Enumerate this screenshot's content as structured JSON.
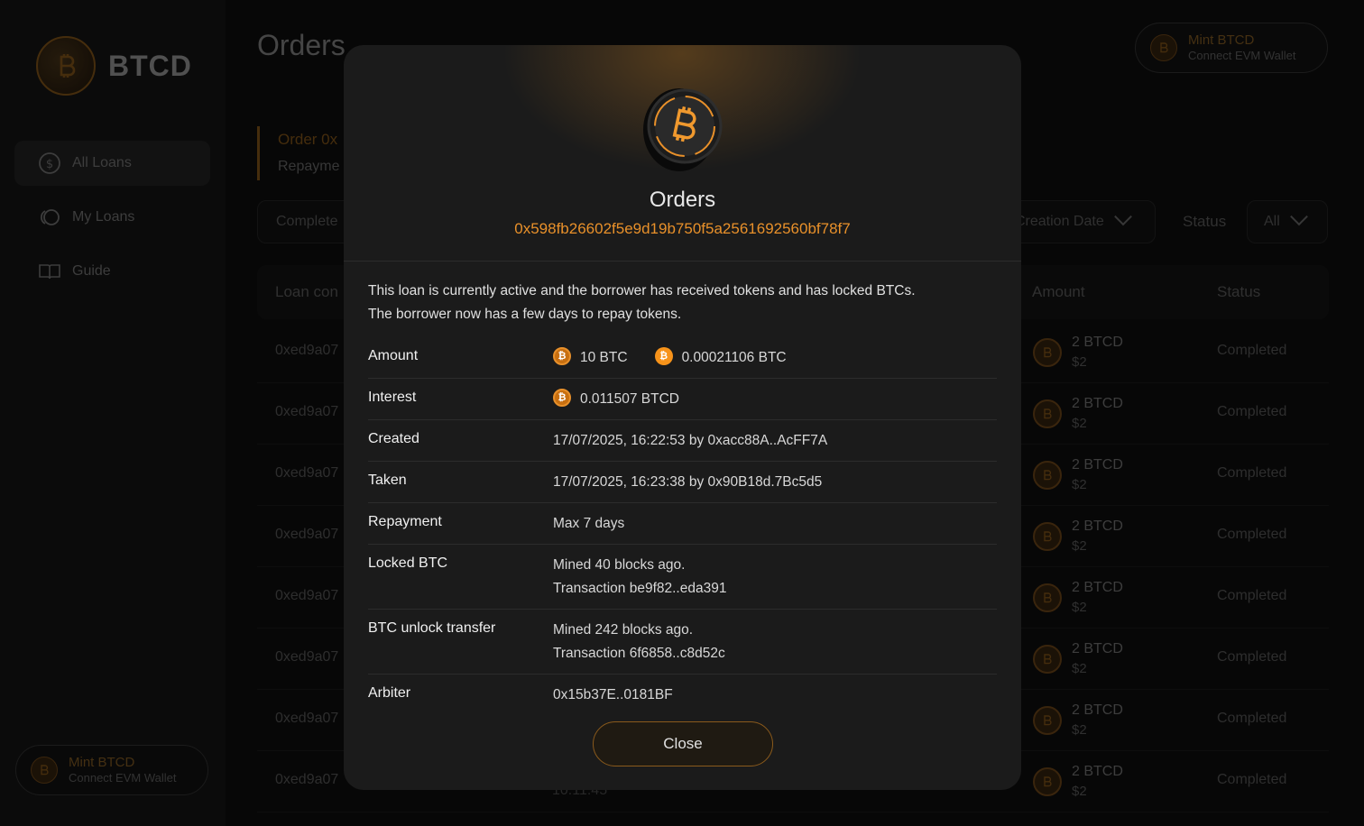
{
  "app": {
    "brand": "BTCD",
    "page_title": "Orders"
  },
  "sidebar": {
    "items": [
      {
        "label": "All Loans",
        "icon": "dollar-circle-icon",
        "active": true
      },
      {
        "label": "My Loans",
        "icon": "loop-icon",
        "active": false
      },
      {
        "label": "Guide",
        "icon": "book-icon",
        "active": false
      }
    ],
    "mint": {
      "title": "Mint BTCD",
      "subtitle": "Connect EVM Wallet"
    }
  },
  "header": {
    "mint": {
      "title": "Mint BTCD",
      "subtitle": "Connect EVM Wallet"
    }
  },
  "background": {
    "order_card": {
      "line1": "Order 0x",
      "line2": "Repayme"
    },
    "filters": {
      "completed": "Complete",
      "creation_date": "Creation Date",
      "status_label": "Status",
      "status_value": "All"
    },
    "columns": {
      "loan": "Loan con",
      "amount": "Amount",
      "status": "Status"
    },
    "rows": [
      {
        "id": "0xed9a07",
        "amount": "2 BTCD",
        "usd": "$2",
        "status": "Completed"
      },
      {
        "id": "0xed9a07",
        "amount": "2 BTCD",
        "usd": "$2",
        "status": "Completed"
      },
      {
        "id": "0xed9a07",
        "amount": "2 BTCD",
        "usd": "$2",
        "status": "Completed"
      },
      {
        "id": "0xed9a07",
        "amount": "2 BTCD",
        "usd": "$2",
        "status": "Completed"
      },
      {
        "id": "0xed9a07",
        "amount": "2 BTCD",
        "usd": "$2",
        "status": "Completed"
      },
      {
        "id": "0xed9a07",
        "amount": "2 BTCD",
        "usd": "$2",
        "status": "Completed"
      },
      {
        "id": "0xed9a07",
        "amount": "2 BTCD",
        "usd": "$2",
        "status": "Completed"
      },
      {
        "id": "0xed9a07",
        "amount": "2 BTCD",
        "usd": "$2",
        "status": "Completed"
      }
    ],
    "partial_time": "10:11:45"
  },
  "modal": {
    "title": "Orders",
    "hash": "0x598fb26602f5e9d19b750f5a2561692560bf78f7",
    "description_line1": "This loan is currently active and the borrower has received tokens and has locked BTCs.",
    "description_line2": "The borrower now has a few days to repay tokens.",
    "details": {
      "amount": {
        "label": "Amount",
        "btc": "10 BTC",
        "btc2": "0.00021106 BTC"
      },
      "interest": {
        "label": "Interest",
        "value": "0.011507 BTCD"
      },
      "created": {
        "label": "Created",
        "value": "17/07/2025, 16:22:53 by 0xacc88A..AcFF7A"
      },
      "taken": {
        "label": "Taken",
        "value": "17/07/2025, 16:23:38 by 0x90B18d.7Bc5d5"
      },
      "repayment": {
        "label": "Repayment",
        "value": "Max 7 days"
      },
      "locked_btc": {
        "label": "Locked BTC",
        "line1": "Mined 40 blocks ago.",
        "line2": "Transaction be9f82..eda391"
      },
      "unlock": {
        "label": "BTC unlock transfer",
        "line1": "Mined 242 blocks ago.",
        "line2": "Transaction 6f6858..c8d52c"
      },
      "arbiter": {
        "label": "Arbiter",
        "value": "0x15b37E..0181BF"
      }
    },
    "close_label": "Close"
  },
  "colors": {
    "accent": "#e8902a",
    "btc": "#f7931a",
    "modal_bg": "#1b1b1b",
    "page_bg": "#0b0b0b"
  }
}
